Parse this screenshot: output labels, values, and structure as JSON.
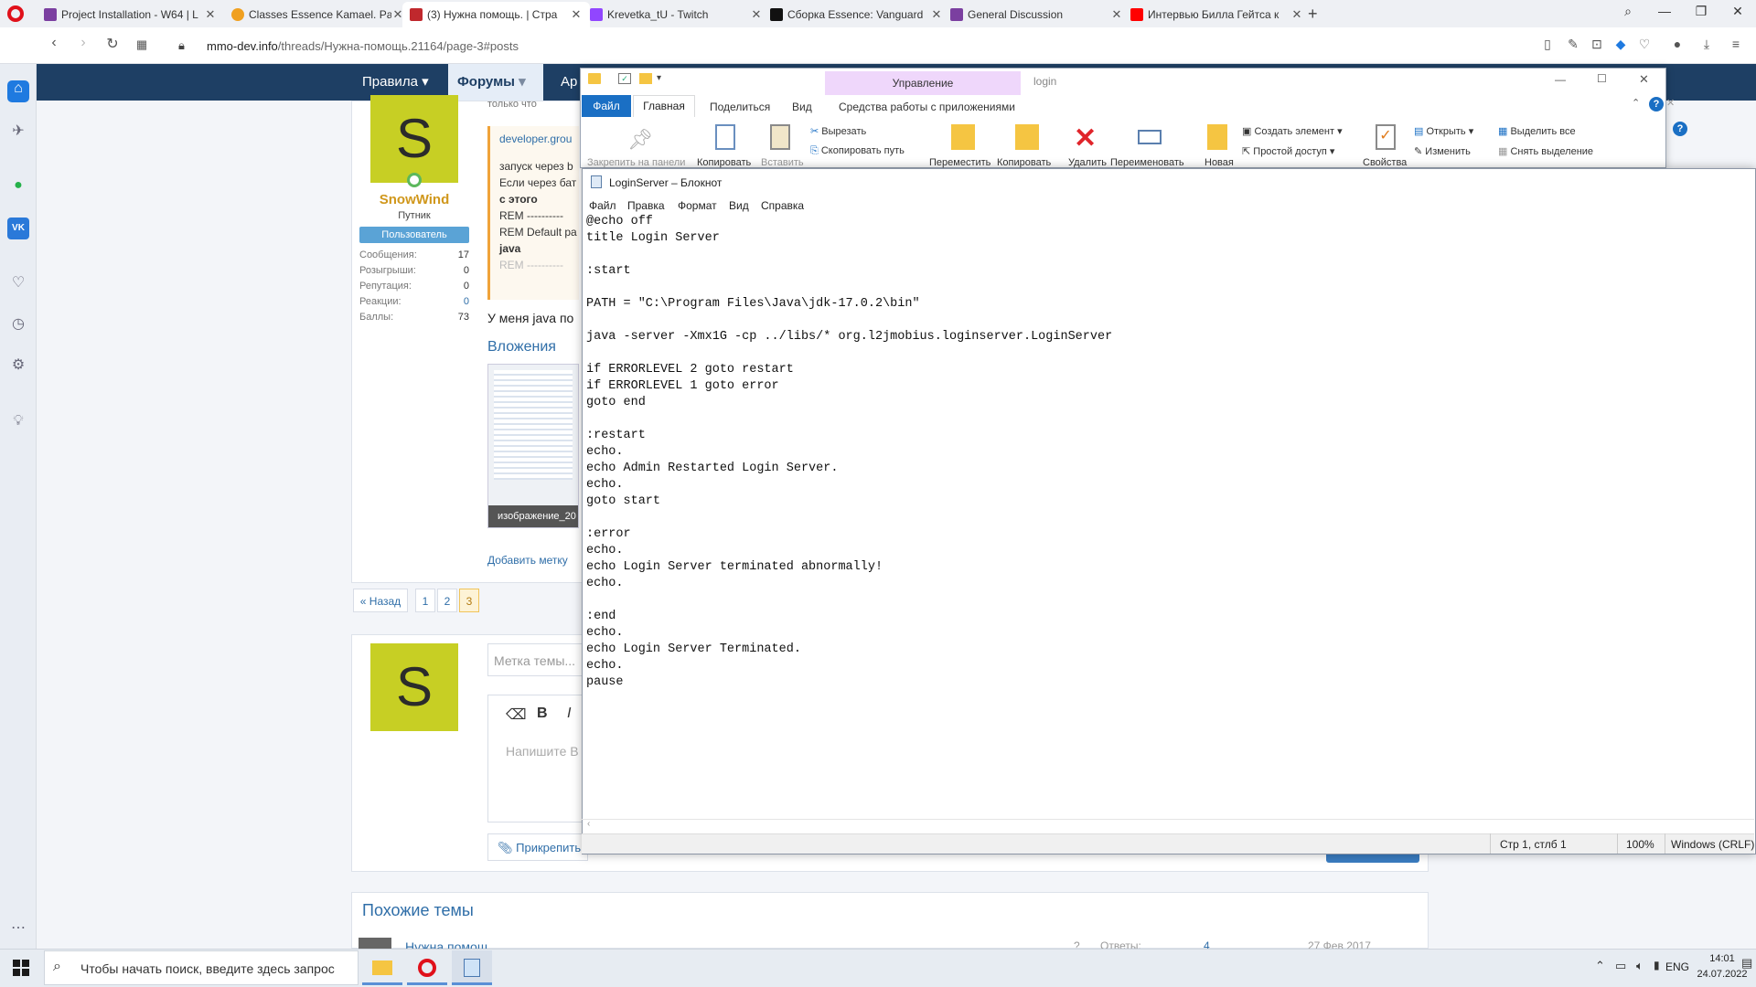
{
  "browser": {
    "tabs": [
      {
        "title": "Project Installation - W64 | L",
        "color": "#7b3fa0"
      },
      {
        "title": "Classes Essence Kamael. Pa",
        "color": "#f0a020"
      },
      {
        "title": "(3) Нужна помощь. | Стра",
        "color": "#c0282d"
      },
      {
        "title": "Krevetka_tU - Twitch",
        "color": "#9146ff"
      },
      {
        "title": "Сборка Essence: Vanguard",
        "color": "#111111"
      },
      {
        "title": "General Discussion",
        "color": "#7b3fa0"
      },
      {
        "title": "Интервью Билла Гейтса к",
        "color": "#ff0000"
      }
    ],
    "url_host": "mmo-dev.info",
    "url_path": "/threads/Нужна-помощь.21164/page-3#posts"
  },
  "site": {
    "nav": [
      "Правила",
      "Форумы",
      "Ар"
    ],
    "user": {
      "name": "SnowWind",
      "initial": "S",
      "role": "Путник",
      "badge": "Пользователь"
    },
    "stats": [
      {
        "label": "Сообщения:",
        "value": "17"
      },
      {
        "label": "Розыгрыши:",
        "value": "0"
      },
      {
        "label": "Репутация:",
        "value": "0"
      },
      {
        "label": "Реакции:",
        "value": "0"
      },
      {
        "label": "Баллы:",
        "value": "73"
      }
    ],
    "snippet_top": "только что",
    "quote_source": "developer.grou",
    "quote_lines": [
      "запуск через b",
      "Если через бат",
      "с этого",
      "REM ----------",
      "REM Default pa",
      "java",
      "REM ----------"
    ],
    "body_text": "У меня java по",
    "attachments_title": "Вложения",
    "attachment_caption": "изображение_20",
    "add_tag": "Добавить метку",
    "pager": {
      "back": "« Назад",
      "pages": [
        "1",
        "2",
        "3"
      ]
    },
    "reply": {
      "tag_placeholder": "Метка темы...",
      "body_placeholder": "Напишите В",
      "attach": "Прикрепить"
    },
    "similar": {
      "title": "Похожие темы",
      "thread": "Нужна помощ",
      "replies_label": "Ответы:",
      "replies": "4",
      "date": "27 Фев 2017"
    }
  },
  "explorer": {
    "title": "login",
    "context_tab": "Управление",
    "tabs": [
      "Файл",
      "Главная",
      "Поделиться",
      "Вид",
      "Средства работы с приложениями"
    ],
    "buttons": {
      "pin": "Закрепить на панели",
      "copy": "Копировать",
      "paste": "Вставить",
      "cut": "Вырезать",
      "copy_path": "Скопировать путь",
      "move": "Переместить",
      "copy_to": "Копировать",
      "delete": "Удалить",
      "rename": "Переименовать",
      "new": "Новая",
      "new_item": "Создать элемент",
      "easy_access": "Простой доступ",
      "properties": "Свойства",
      "open": "Открыть",
      "edit": "Изменить",
      "select_all": "Выделить все",
      "select_none": "Снять выделение"
    }
  },
  "notepad": {
    "title": "LoginServer – Блокнот",
    "menu": [
      "Файл",
      "Правка",
      "Формат",
      "Вид",
      "Справка"
    ],
    "content": "@echo off\ntitle Login Server\n\n:start\n\nPATH = \"C:\\Program Files\\Java\\jdk-17.0.2\\bin\"\n\njava -server -Xmx1G -cp ../libs/* org.l2jmobius.loginserver.LoginServer\n\nif ERRORLEVEL 2 goto restart\nif ERRORLEVEL 1 goto error\ngoto end\n\n:restart\necho.\necho Admin Restarted Login Server.\necho.\ngoto start\n\n:error\necho.\necho Login Server terminated abnormally!\necho.\n\n:end\necho.\necho Login Server Terminated.\necho.\npause",
    "status": {
      "position": "Стр 1, стлб 1",
      "zoom": "100%",
      "eol": "Windows (CRLF)"
    }
  },
  "taskbar": {
    "search_placeholder": "Чтобы начать поиск, введите здесь запрос",
    "lang": "ENG",
    "time": "14:01",
    "date": "24.07.2022"
  }
}
